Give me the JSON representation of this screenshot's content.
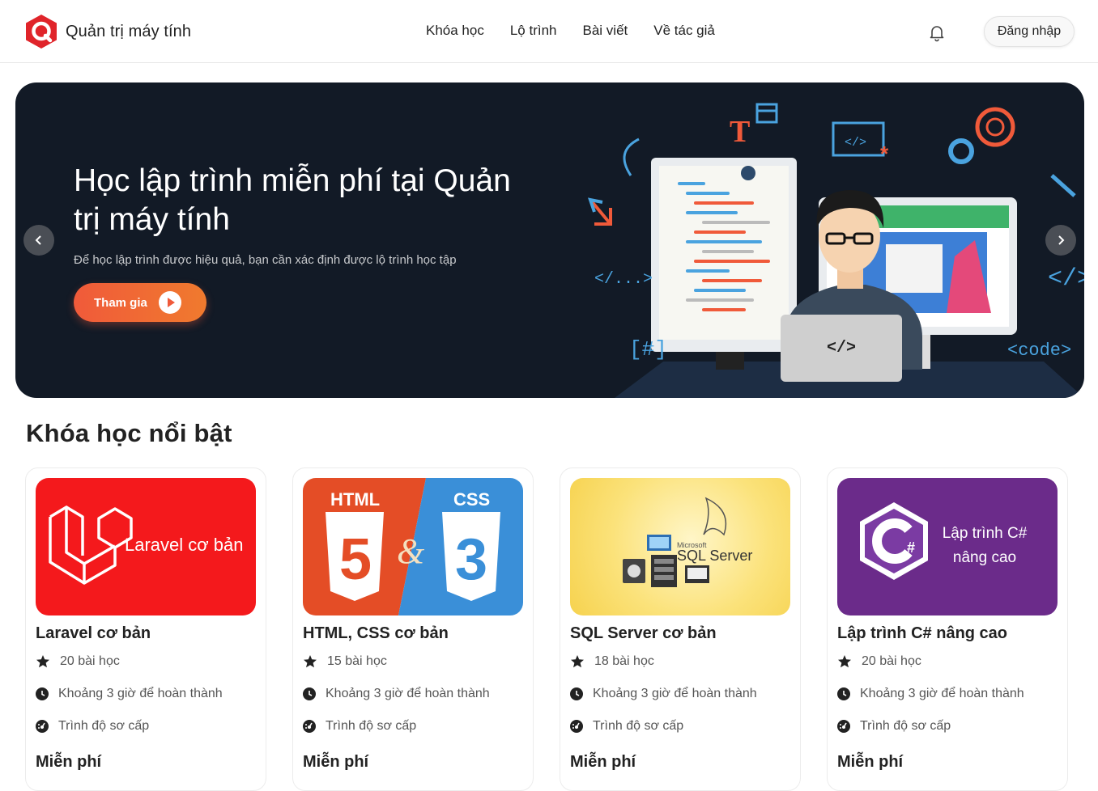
{
  "header": {
    "brand": "Quản trị máy tính",
    "nav": [
      "Khóa học",
      "Lộ trình",
      "Bài viết",
      "Về tác giả"
    ],
    "login_label": "Đăng nhập"
  },
  "banner": {
    "title": "Học lập trình miễn phí tại Quản trị máy tính",
    "subtitle": "Để học lập trình được hiệu quả, bạn cần xác định được lộ trình học tập",
    "cta_label": "Tham gia",
    "code_tags": [
      "</...>",
      "[#]",
      "</>",
      "<code>"
    ]
  },
  "section": {
    "title": "Khóa học nổi bật"
  },
  "courses": [
    {
      "image_text": "Laravel cơ bản",
      "title": "Laravel cơ bản",
      "lessons": "20 bài học",
      "duration": "Khoảng 3 giờ để hoàn thành",
      "level": "Trình độ sơ cấp",
      "price": "Miễn phí"
    },
    {
      "image_text_1": "HTML",
      "image_text_2": "CSS",
      "title": "HTML, CSS cơ bản",
      "lessons": "15 bài học",
      "duration": "Khoảng 3 giờ để hoàn thành",
      "level": "Trình độ sơ cấp",
      "price": "Miễn phí"
    },
    {
      "image_text_1": "Microsoft",
      "image_text_2": "SQL Server",
      "title": "SQL Server cơ bản",
      "lessons": "18 bài học",
      "duration": "Khoảng 3 giờ để hoàn thành",
      "level": "Trình độ sơ cấp",
      "price": "Miễn phí"
    },
    {
      "image_text_1": "Lập trình C#",
      "image_text_2": "nâng cao",
      "title": "Lập trình C# nâng cao",
      "lessons": "20 bài học",
      "duration": "Khoảng 3 giờ để hoàn thành",
      "level": "Trình độ sơ cấp",
      "price": "Miễn phí"
    }
  ],
  "colors": {
    "accent": "#f05a3a",
    "banner_bg": "#121a26",
    "brand_red": "#e0242a"
  }
}
